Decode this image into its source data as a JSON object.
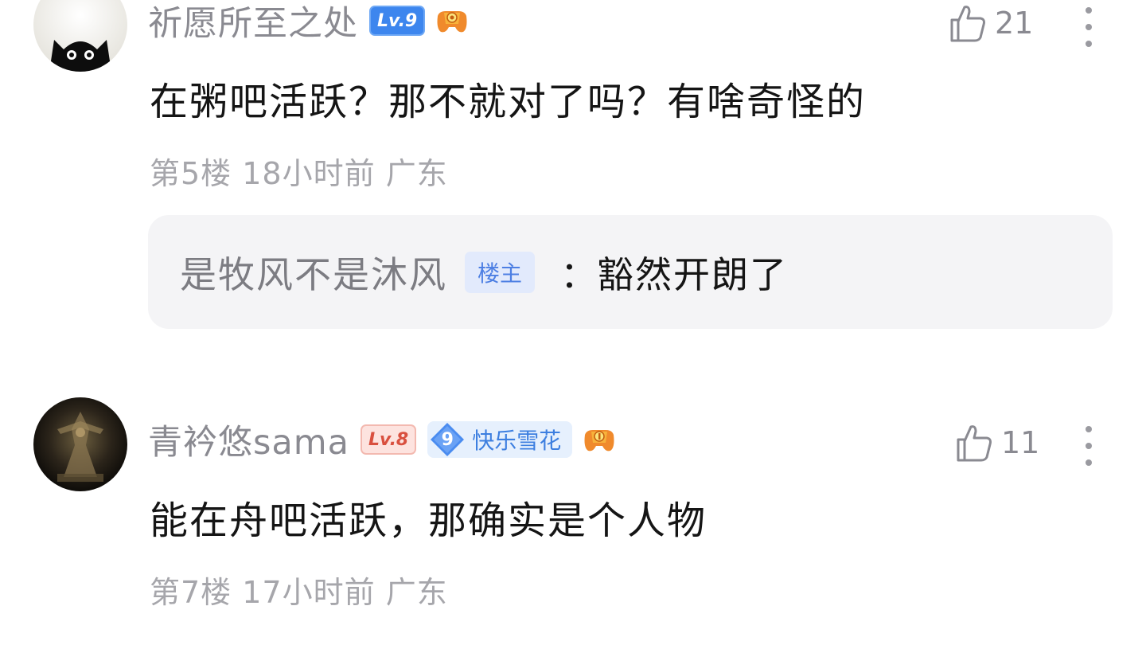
{
  "comments": [
    {
      "username": "祈愿所至之处",
      "level": "Lv.9",
      "level_color": "#3d86ee",
      "medal_icon": "orange-gamepad-medal-icon",
      "likes": "21",
      "content": "在粥吧活跃？那不就对了吗？有啥奇怪的",
      "meta": "第5楼 18小时前 广东",
      "reply": {
        "username": "是牧风不是沐风",
        "op_badge": "楼主",
        "colon": "：",
        "text": "豁然开朗了"
      }
    },
    {
      "username": "青衿悠sama",
      "level": "Lv.8",
      "level_color": "#d9503f",
      "fan_badge": {
        "level": "9",
        "label": "快乐雪花"
      },
      "medal_icon": "orange-gamepad-medal-icon",
      "likes": "11",
      "content": "能在舟吧活跃，那确实是个人物",
      "meta": "第7楼 17小时前 广东"
    }
  ]
}
